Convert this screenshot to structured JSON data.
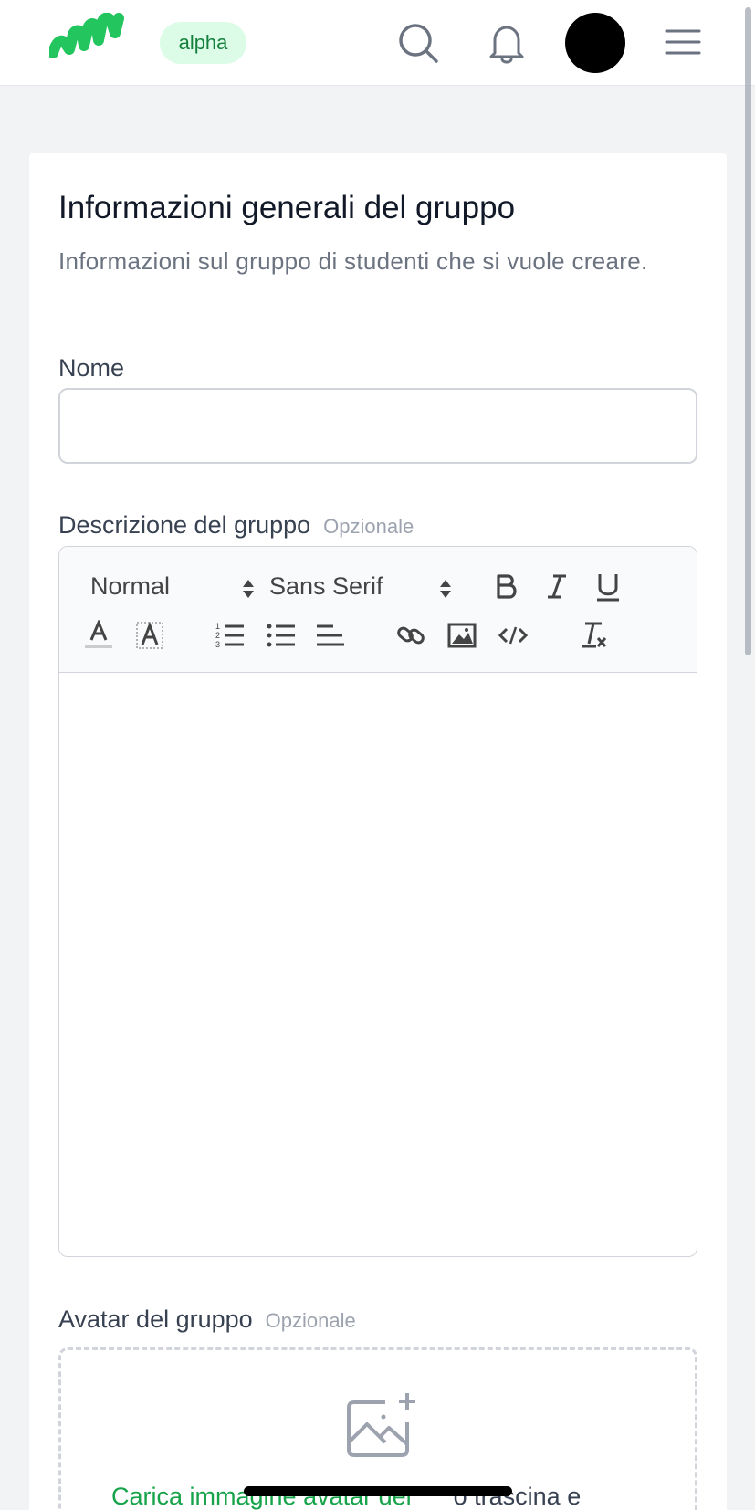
{
  "header": {
    "badge": "alpha"
  },
  "form": {
    "title": "Informazioni generali del gruppo",
    "subtitle": "Informazioni sul gruppo di studenti che si vuole creare.",
    "name_label": "Nome",
    "name_value": "",
    "description_label": "Descrizione del gruppo",
    "optional": "Opzionale",
    "editor": {
      "header_select": "Normal",
      "font_select": "Sans Serif"
    },
    "avatar_label": "Avatar del gruppo",
    "upload_link": "Carica immagine avatar del",
    "upload_rest": "o trascina e"
  },
  "colors": {
    "brand": "#22c55e",
    "badge_bg": "#dcfce7",
    "badge_text": "#15803d",
    "link": "#16a34a"
  },
  "icons": [
    "logo-icon",
    "search-icon",
    "bell-icon",
    "menu-icon",
    "font-color-icon",
    "background-color-icon",
    "ordered-list-icon",
    "bullet-list-icon",
    "align-left-icon",
    "link-icon",
    "image-icon",
    "code-icon",
    "clear-format-icon",
    "bold-icon",
    "italic-icon",
    "underline-icon",
    "photo-add-icon"
  ]
}
